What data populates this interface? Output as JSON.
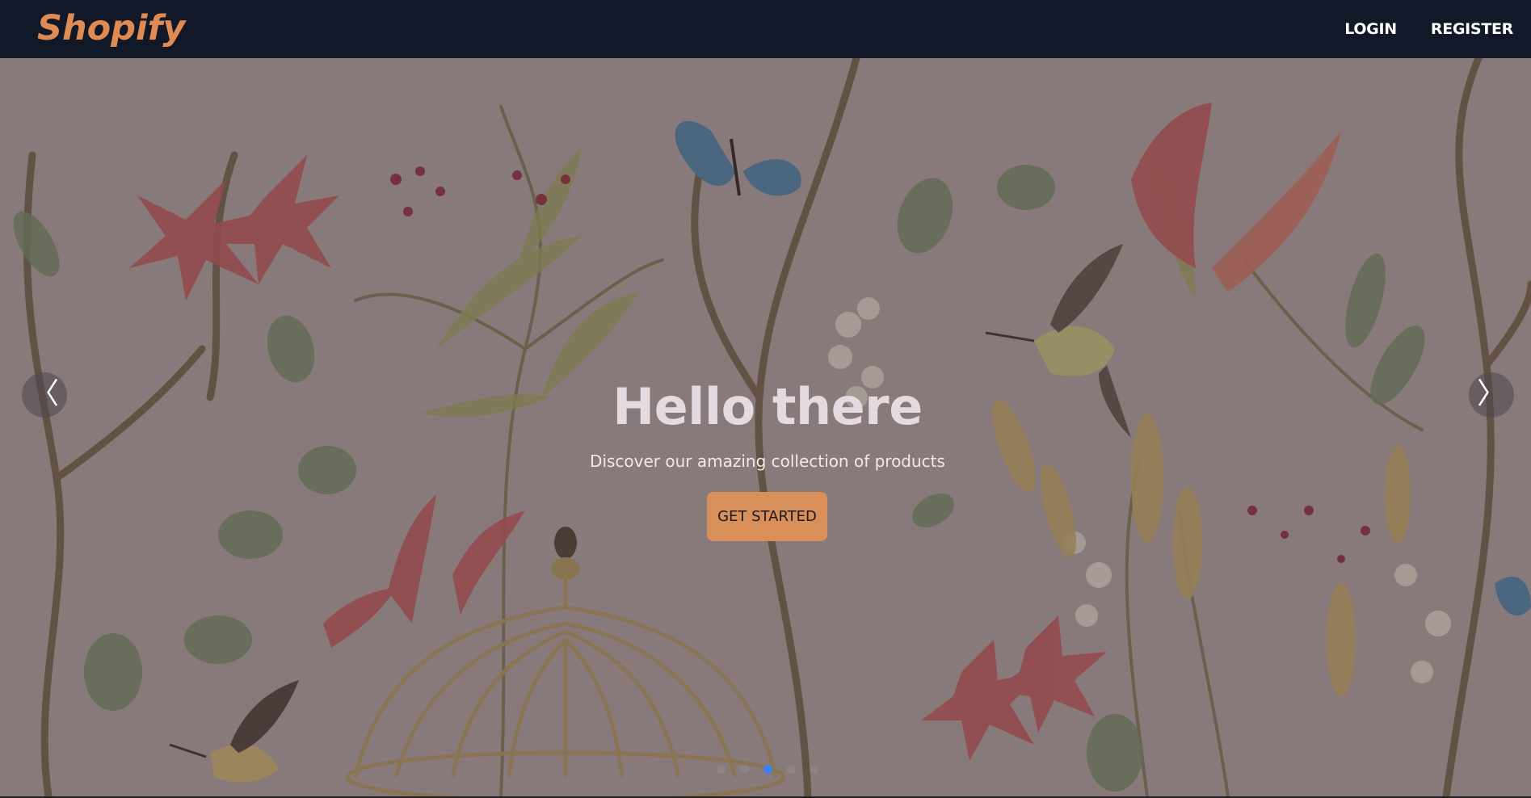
{
  "navbar": {
    "logo": "Shopify",
    "login_label": "LOGIN",
    "register_label": "REGISTER"
  },
  "hero": {
    "title": "Hello there",
    "subtitle": "Discover our amazing collection of products",
    "cta_label": "GET STARTED",
    "prev_arrow": "〈",
    "next_arrow": "〉",
    "slide_count": 5,
    "active_slide": 3
  },
  "colors": {
    "navbar_bg": "#111827",
    "brand_accent": "#e08a54",
    "cta_bg": "#d98f5a",
    "active_indicator": "#3b82f6"
  },
  "icons": {
    "prev": "chevron-left-icon",
    "next": "chevron-right-icon"
  }
}
